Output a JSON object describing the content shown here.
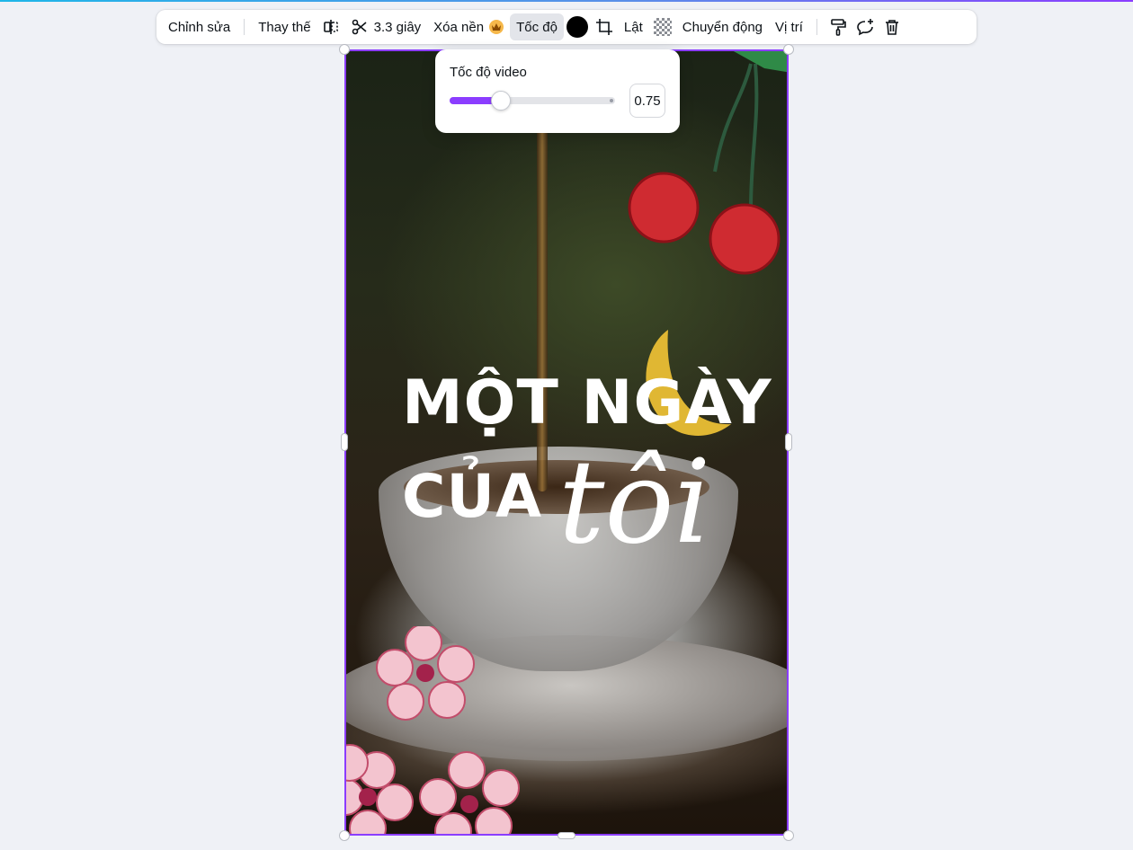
{
  "toolbar": {
    "edit_label": "Chỉnh sửa",
    "replace_label": "Thay thế",
    "duration_label": "3.3 giây",
    "remove_bg_label": "Xóa nền",
    "speed_label": "Tốc độ",
    "flip_label": "Lật",
    "animate_label": "Chuyển động",
    "position_label": "Vị trí",
    "color_value": "#000000"
  },
  "speed_popover": {
    "title": "Tốc độ video",
    "value": "0.75",
    "slider_fraction": 0.31
  },
  "design": {
    "line1": "MỘT NGÀY",
    "line2": "CỦA",
    "script_word": "tôi"
  },
  "colors": {
    "accent": "#8b3dff",
    "toolbar_active": "#e3e5ea",
    "canvas_bg": "#eff1f6"
  }
}
